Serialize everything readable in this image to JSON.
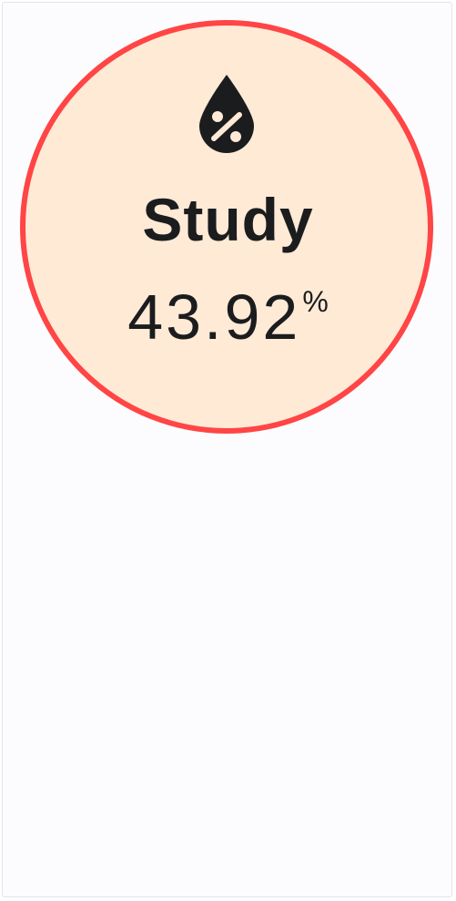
{
  "widget": {
    "icon": "water-percent-icon",
    "label": "Study",
    "value": "43.92",
    "unit": "%",
    "colors": {
      "ring": "#ff4545",
      "fill": "#ffead6",
      "text": "#1b1c1e"
    }
  }
}
